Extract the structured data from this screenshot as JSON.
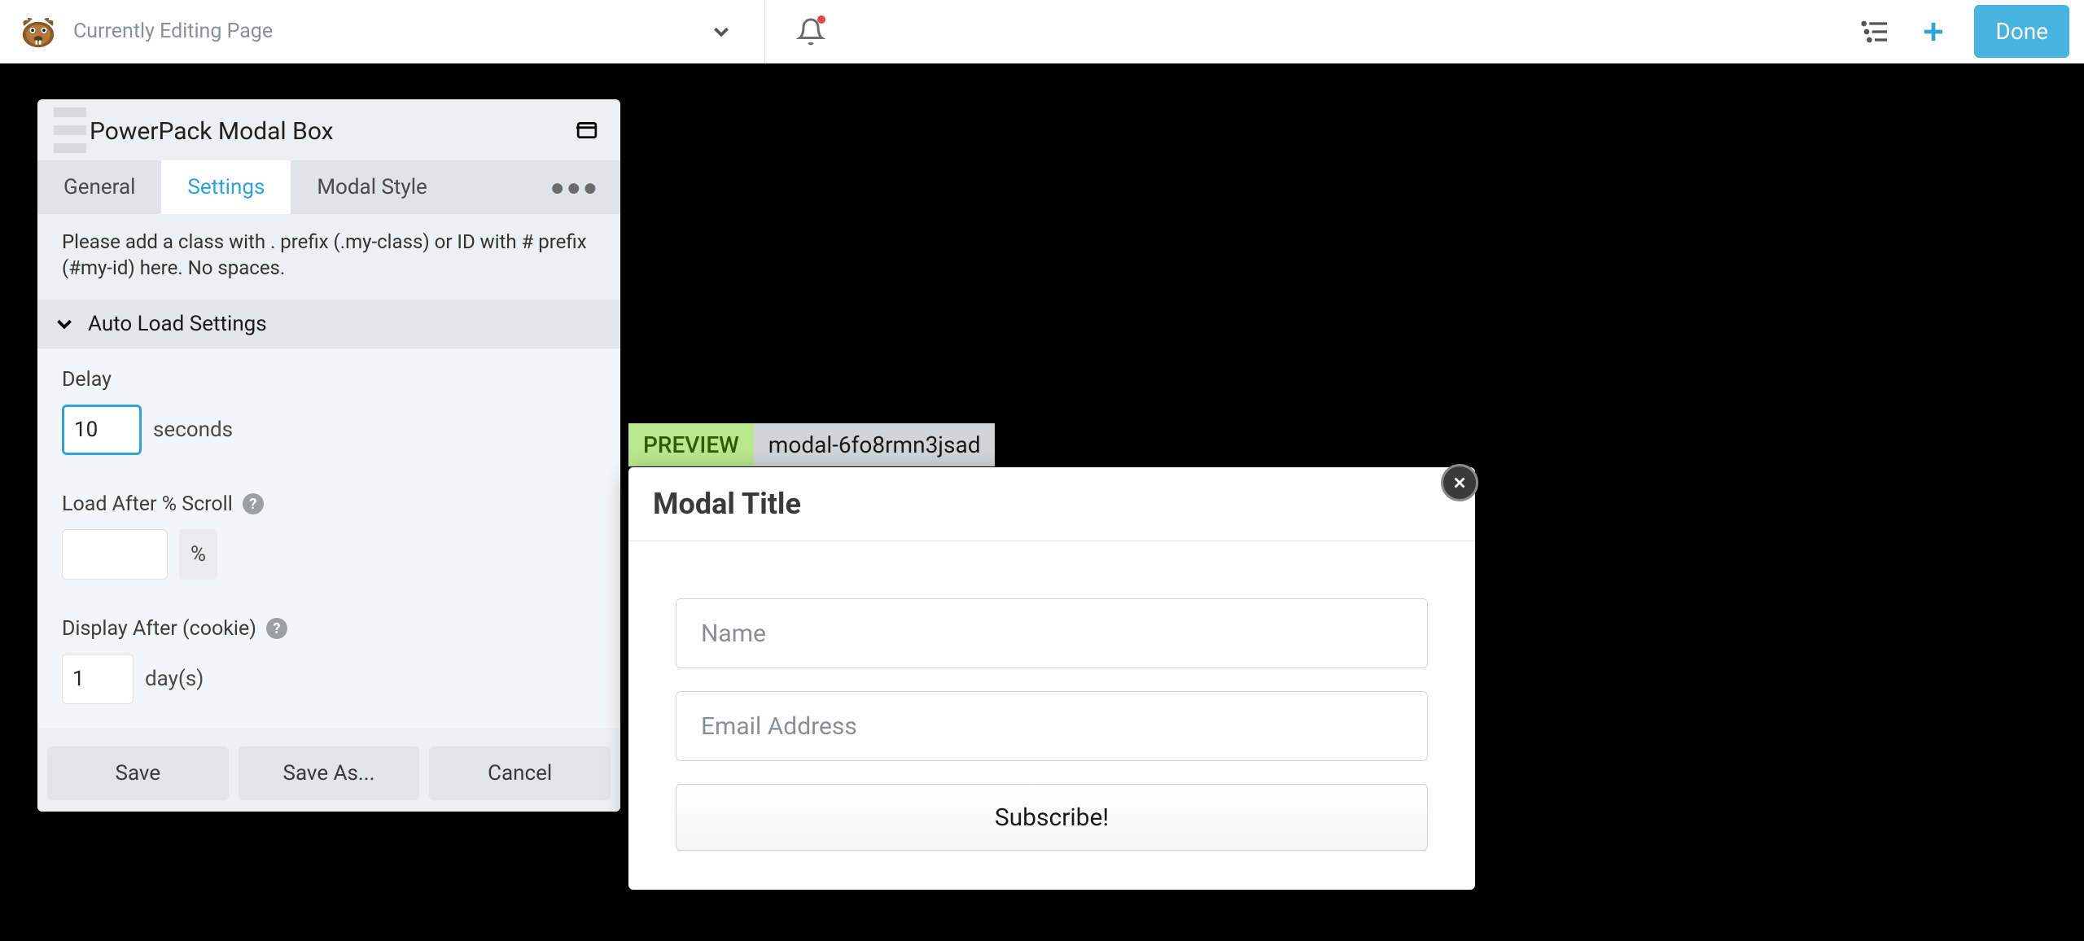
{
  "topbar": {
    "page_title": "Currently Editing Page",
    "done_label": "Done"
  },
  "panel": {
    "title": "PowerPack Modal Box",
    "tabs": {
      "general": "General",
      "settings": "Settings",
      "modal_style": "Modal Style"
    },
    "help_text": "Please add a class with . prefix (.my-class) or ID with # prefix (#my-id) here. No spaces.",
    "section_title": "Auto Load Settings",
    "fields": {
      "delay_label": "Delay",
      "delay_value": "10",
      "delay_unit": "seconds",
      "scroll_label": "Load After % Scroll",
      "scroll_value": "",
      "scroll_unit": "%",
      "cookie_label": "Display After (cookie)",
      "cookie_value": "1",
      "cookie_unit": "day(s)"
    },
    "footer": {
      "save": "Save",
      "save_as": "Save As...",
      "cancel": "Cancel"
    }
  },
  "preview": {
    "badge": "PREVIEW",
    "modal_id": "modal-6fo8rmn3jsad"
  },
  "modal": {
    "title": "Modal Title",
    "name_placeholder": "Name",
    "email_placeholder": "Email Address",
    "submit_label": "Subscribe!"
  }
}
